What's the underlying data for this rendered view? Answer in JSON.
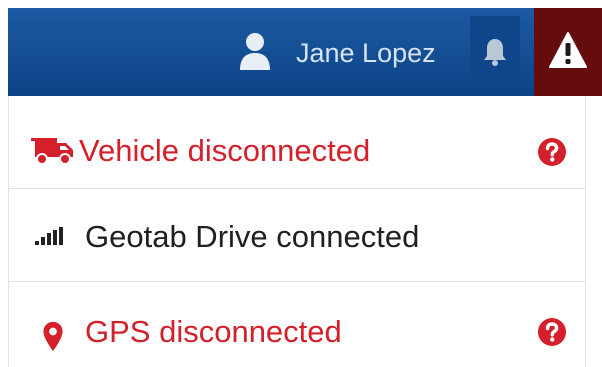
{
  "header": {
    "user_name": "Jane Lopez",
    "colors": {
      "bar": "#0c4386",
      "alert_bg": "#650c0c"
    }
  },
  "status_items": [
    {
      "label": "Vehicle disconnected",
      "state": "disconnected",
      "icon": "truck-icon",
      "has_help": true,
      "color": "#d3202b"
    },
    {
      "label": "Geotab Drive connected",
      "state": "connected",
      "icon": "signal-bars-icon",
      "has_help": false,
      "color": "#202020"
    },
    {
      "label": "GPS disconnected",
      "state": "disconnected",
      "icon": "map-marker-icon",
      "has_help": true,
      "color": "#d3202b"
    }
  ]
}
